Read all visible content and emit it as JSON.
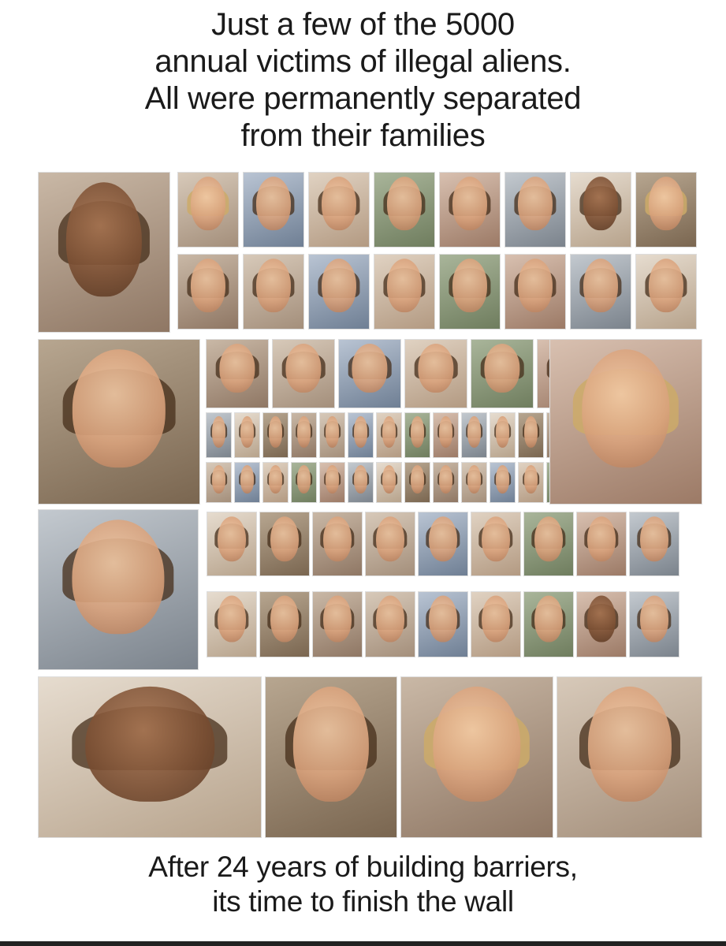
{
  "headline": {
    "lines": [
      "Just a few of the 5000",
      "annual victims of illegal aliens.",
      "All were permanently separated",
      "from their families"
    ]
  },
  "footer": {
    "lines": [
      "After 24 years of building barriers,",
      "its time to finish the wall"
    ]
  },
  "colors": {
    "text": "#1a1a1a",
    "background": "#ffffff"
  }
}
